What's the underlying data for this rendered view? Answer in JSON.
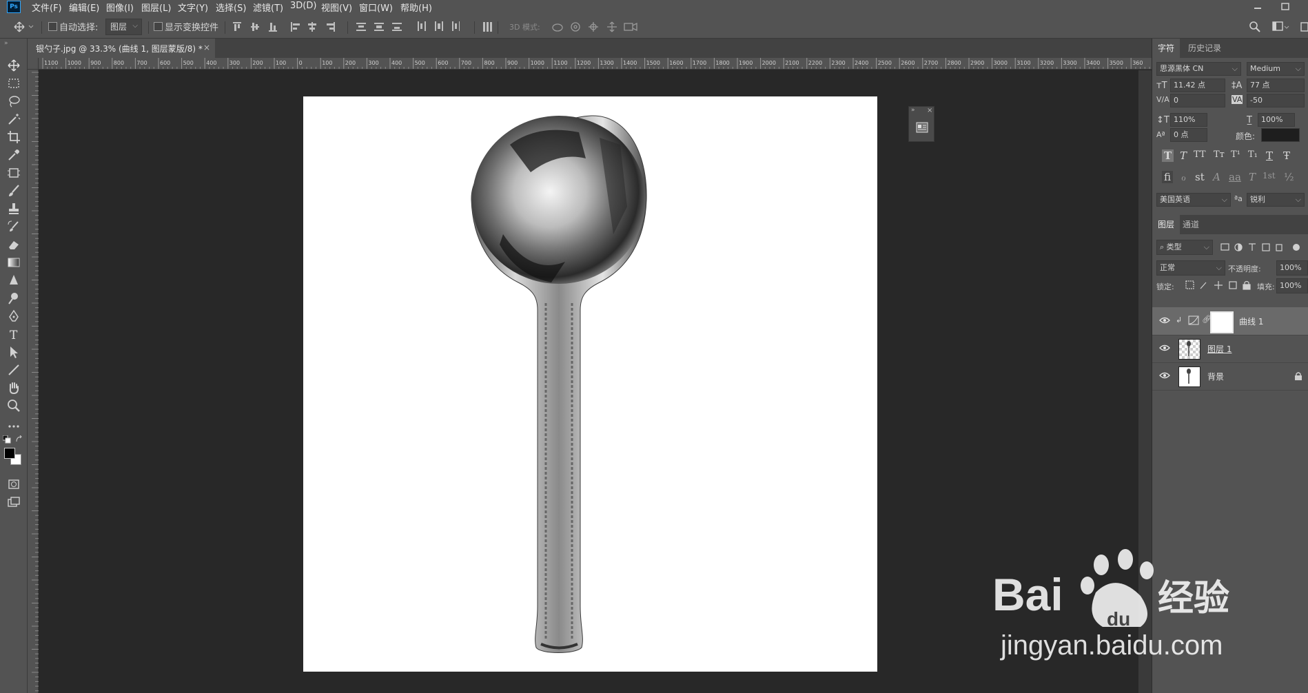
{
  "app": {
    "logo": "Ps"
  },
  "menu": [
    "文件(F)",
    "编辑(E)",
    "图像(I)",
    "图层(L)",
    "文字(Y)",
    "选择(S)",
    "滤镜(T)",
    "3D(D)",
    "视图(V)",
    "窗口(W)",
    "帮助(H)"
  ],
  "options": {
    "auto_select_label": "自动选择:",
    "auto_select_value": "图层",
    "show_transform_label": "显示变换控件",
    "mode3d_label": "3D 模式:"
  },
  "document": {
    "tab_title": "银勺子.jpg @ 33.3% (曲线 1, 图层蒙版/8) *",
    "close": "×"
  },
  "ruler": {
    "h_ticks": [
      "1100",
      "1000",
      "900",
      "800",
      "700",
      "600",
      "500",
      "400",
      "300",
      "200",
      "100",
      "0",
      "100",
      "200",
      "300",
      "400",
      "500",
      "600",
      "700",
      "800",
      "900",
      "1000",
      "1100",
      "1200",
      "1300",
      "1400",
      "1500",
      "1600",
      "1700",
      "1800",
      "1900",
      "2000",
      "2100",
      "2200",
      "2300",
      "2400",
      "2500",
      "2600",
      "2700",
      "2800",
      "2900",
      "3000",
      "3100",
      "3200",
      "3300",
      "3400",
      "3500",
      "360"
    ]
  },
  "character_panel": {
    "tabs": [
      "字符",
      "历史记录"
    ],
    "font_family": "思源黑体 CN",
    "font_style": "Medium",
    "font_size": "11.42 点",
    "leading": "77 点",
    "kerning": "0",
    "tracking": "-50",
    "vertical_scale": "110%",
    "horizontal_scale": "100%",
    "baseline_shift": "0 点",
    "color_label": "颜色:",
    "color_value": "#1e1e1e",
    "style_glyphs": [
      "T",
      "T",
      "TT",
      "Tт",
      "T¹",
      "T₁",
      "T",
      "Ŧ"
    ],
    "opentype_glyphs": [
      "fi",
      "ℴ",
      "st",
      "A",
      "aa",
      "T",
      "1st",
      "½"
    ],
    "language": "美国英语",
    "aa_label": "ªa",
    "antialias": "锐利"
  },
  "layers_panel": {
    "tabs": [
      "图层",
      "通道"
    ],
    "filter_kind": "类型",
    "blend_mode": "正常",
    "opacity_label": "不透明度:",
    "opacity_value": "100%",
    "lock_label": "锁定:",
    "fill_label": "填充:",
    "fill_value": "100%",
    "layers": [
      {
        "name": "曲线 1",
        "selected": true,
        "type": "adjustment"
      },
      {
        "name": "图层 1",
        "selected": false,
        "type": "pixel"
      },
      {
        "name": "背景",
        "selected": false,
        "type": "background",
        "locked": true
      }
    ]
  },
  "watermark": {
    "brand": "Bai",
    "brand2": "经验",
    "url": "jingyan.baidu.com"
  }
}
